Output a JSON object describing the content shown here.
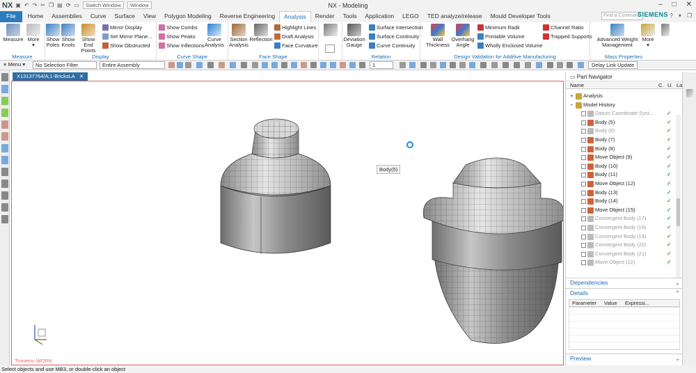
{
  "titlebar": {
    "app_logo": "NX",
    "switch_window": "Switch Window",
    "window_menu": "Window",
    "title": "NX - Modeling",
    "brand": "SIEMENS",
    "find_placeholder": "Find a Command"
  },
  "tabs": [
    "File",
    "Home",
    "Assemblies",
    "Curve",
    "Surface",
    "View",
    "Polygon Modeling",
    "Reverse Engineering",
    "Analysis",
    "Render",
    "Tools",
    "Application",
    "LEGO",
    "TED analyze/release",
    "Mould Developer Tools"
  ],
  "active_tab": "Analysis",
  "ribbon": {
    "measure": {
      "measure": "Measure",
      "more": "More",
      "group": "Measure"
    },
    "display": {
      "show_poles": "Show Poles",
      "show_knots": "Show Knots",
      "show_end_points": "Show End Points",
      "mirror_display": "Mirror Display",
      "set_mirror_plane": "Set Mirror Plane...",
      "show_obstructed": "Show Obstructed",
      "group": "Display"
    },
    "curve_shape": {
      "show_combs": "Show Combs",
      "show_peaks": "Show Peaks",
      "show_inflections": "Show Inflections",
      "curve_analysis": "Curve Analysis",
      "group": "Curve Shape"
    },
    "face_shape": {
      "section_analysis": "Section Analysis",
      "reflection": "Reflection",
      "highlight_lines": "Highlight Lines",
      "draft_analysis": "Draft Analysis",
      "face_curvature": "Face Curvature",
      "group": "Face Shape"
    },
    "relation": {
      "deviation_gauge": "Deviation Gauge",
      "surface_intersection": "Surface Intersection",
      "surface_continuity": "Surface Continuity",
      "curve_continuity": "Curve Continuity",
      "group": "Relation"
    },
    "additive": {
      "wall_thickness": "Wall Thickness",
      "overhang_angle": "Overhang Angle",
      "minimum_radii": "Minimum Radii",
      "printable_volume": "Printable Volume",
      "wholly_enclosed_volume": "Wholly Enclosed Volume",
      "channel_ratio": "Channel Ratio",
      "trapped_supports": "Trapped Supports",
      "group": "Design Validation for Additive Manufacturing"
    },
    "mass": {
      "advanced_weight": "Advanced Weight Management",
      "more": "More",
      "group": "Mass Properties"
    }
  },
  "toolbar": {
    "menu": "Menu",
    "selection_filter": "No Selection Filter",
    "assembly_scope": "Entire Assembly",
    "layer_value": "1",
    "delay_link_update": "Delay Link Update"
  },
  "document": {
    "tab": "X13137764/A;1-BricksLA",
    "view_label": "Trimetric WORK",
    "tooltip": "Body(5)"
  },
  "status": {
    "message": "Select objects and use MB3, or double-click an object"
  },
  "part_navigator": {
    "title": "Part Navigator",
    "columns": [
      "Name",
      "C.",
      "U.",
      "La"
    ],
    "items": [
      {
        "label": "Analysis",
        "grey": false,
        "ok": false,
        "indent": 0
      },
      {
        "label": "Model History",
        "grey": false,
        "ok": false,
        "indent": 0
      },
      {
        "label": "Datum Coordinate Syst...",
        "grey": true,
        "ok": true
      },
      {
        "label": "Body (5)",
        "grey": false,
        "ok": true
      },
      {
        "label": "Body (6)",
        "grey": true,
        "ok": true
      },
      {
        "label": "Body (7)",
        "grey": false,
        "ok": true
      },
      {
        "label": "Body (8)",
        "grey": false,
        "ok": true
      },
      {
        "label": "Move Object (9)",
        "grey": false,
        "ok": true
      },
      {
        "label": "Body (10)",
        "grey": false,
        "ok": true
      },
      {
        "label": "Body (11)",
        "grey": false,
        "ok": true
      },
      {
        "label": "Move Object (12)",
        "grey": false,
        "ok": true
      },
      {
        "label": "Body (13)",
        "grey": false,
        "ok": true
      },
      {
        "label": "Body (14)",
        "grey": false,
        "ok": true
      },
      {
        "label": "Move Object (15)",
        "grey": false,
        "ok": true
      },
      {
        "label": "Convergent Body (17)",
        "grey": true,
        "ok": true
      },
      {
        "label": "Convergent Body (18)",
        "grey": true,
        "ok": true
      },
      {
        "label": "Convergent Body (19)",
        "grey": true,
        "ok": true
      },
      {
        "label": "Convergent Body (20)",
        "grey": true,
        "ok": true
      },
      {
        "label": "Convergent Body (21)",
        "grey": true,
        "ok": true
      },
      {
        "label": "Move Object (22)",
        "grey": true,
        "ok": true
      }
    ],
    "dependencies": "Dependencies",
    "details": "Details",
    "details_columns": [
      "Parameter",
      "Value",
      "Expressi..."
    ],
    "preview": "Preview"
  },
  "colors": {
    "accent": "#1a6cb3",
    "file_tab": "#2b7bbf",
    "siemens": "#00889a",
    "viewport_border": "#e06060",
    "ok_check": "#2a9d2a"
  }
}
